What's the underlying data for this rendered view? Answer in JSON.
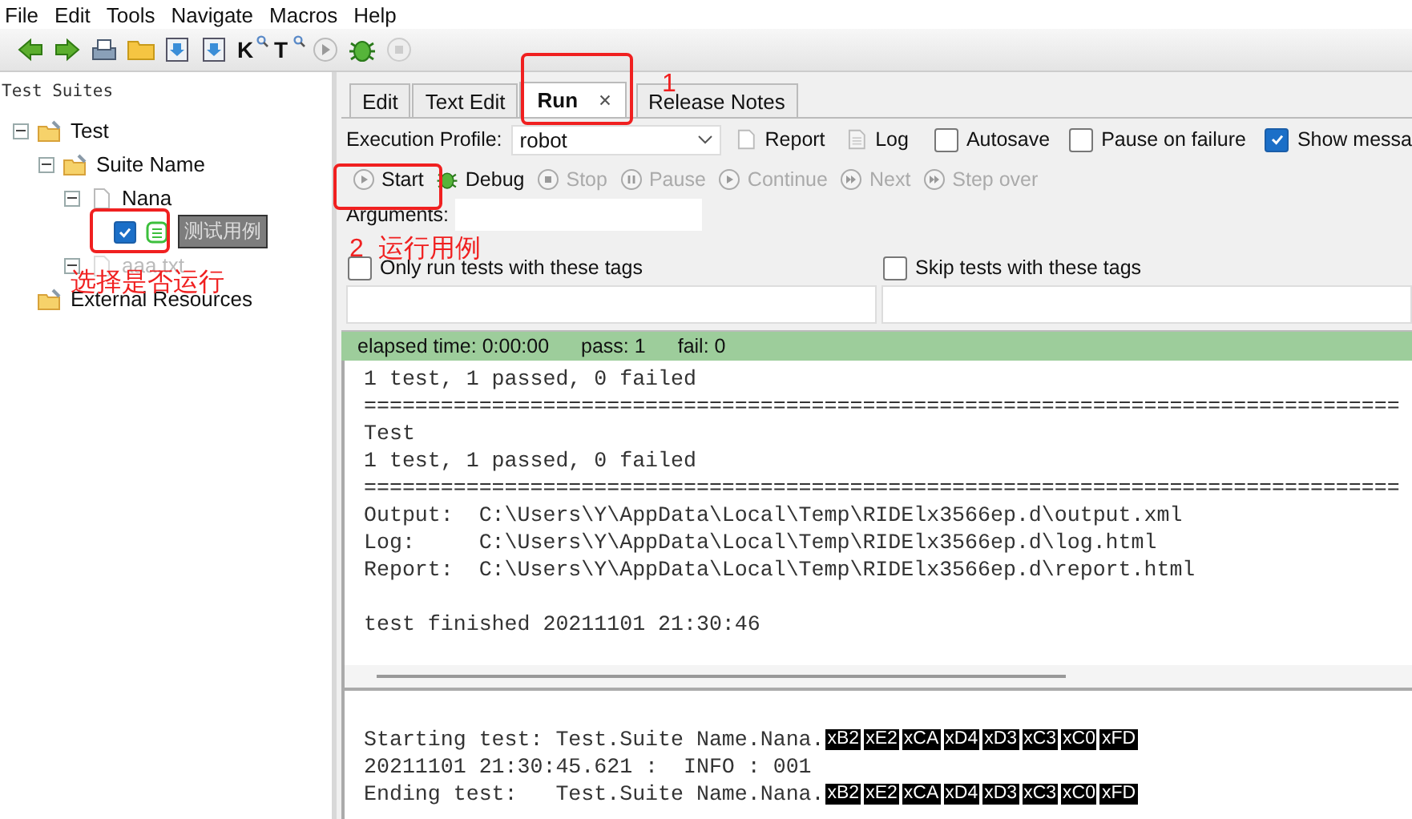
{
  "menu": [
    "File",
    "Edit",
    "Tools",
    "Navigate",
    "Macros",
    "Help"
  ],
  "toolbar": [
    {
      "kind": "back"
    },
    {
      "kind": "forward"
    },
    {
      "kind": "save"
    },
    {
      "kind": "folder"
    },
    {
      "kind": "import"
    },
    {
      "kind": "import"
    },
    {
      "kind": "search",
      "label": "K"
    },
    {
      "kind": "search",
      "label": "T"
    },
    {
      "kind": "run"
    },
    {
      "kind": "debug"
    },
    {
      "kind": "stop"
    }
  ],
  "tree": {
    "title": "Test Suites",
    "items": [
      {
        "label": "Test",
        "kind": "suite",
        "expanded": true,
        "children": [
          {
            "label": "Suite Name",
            "kind": "suite",
            "expanded": true,
            "children": [
              {
                "label": "Nana",
                "kind": "file",
                "expanded": true,
                "children": [
                  {
                    "label": "测试用例",
                    "kind": "test",
                    "checked": true,
                    "selected": true
                  }
                ]
              },
              {
                "label": "aaa.txt",
                "kind": "file",
                "expanded": true,
                "disabled": true
              }
            ]
          }
        ]
      },
      {
        "label": "External Resources",
        "kind": "suite"
      }
    ]
  },
  "tabs": [
    {
      "label": "Edit",
      "selected": false
    },
    {
      "label": "Text Edit",
      "selected": false
    },
    {
      "label": "Run",
      "selected": true
    },
    {
      "label": "Release Notes",
      "selected": false
    }
  ],
  "run": {
    "profile_label": "Execution Profile:",
    "profile": "robot",
    "report": "Report",
    "log": "Log",
    "options": [
      {
        "label": "Autosave",
        "checked": false
      },
      {
        "label": "Pause on failure",
        "checked": false
      },
      {
        "label": "Show messa",
        "checked": true
      }
    ],
    "controls": [
      {
        "label": "Start",
        "kind": "play",
        "disabled": false
      },
      {
        "label": "Debug",
        "kind": "bug",
        "disabled": false
      },
      {
        "label": "Stop",
        "kind": "stop",
        "disabled": true
      },
      {
        "label": "Pause",
        "kind": "pause",
        "disabled": true
      },
      {
        "label": "Continue",
        "kind": "play",
        "disabled": true
      },
      {
        "label": "Next",
        "kind": "next",
        "disabled": true
      },
      {
        "label": "Step over",
        "kind": "next",
        "disabled": true
      }
    ],
    "arguments_label": "Arguments:",
    "tag_filters": [
      {
        "label": "Only run tests with these tags",
        "checked": false
      },
      {
        "label": "Skip tests with these tags",
        "checked": false
      }
    ],
    "status": {
      "elapsed": "elapsed time: 0:00:00",
      "pass": "pass: 1",
      "fail": "fail: 0"
    },
    "output": [
      "1 test, 1 passed, 0 failed",
      "=================================================================================",
      "Test",
      "1 test, 1 passed, 0 failed",
      "=================================================================================",
      "Output:  C:\\Users\\Y\\AppData\\Local\\Temp\\RIDElx3566ep.d\\output.xml",
      "Log:     C:\\Users\\Y\\AppData\\Local\\Temp\\RIDElx3566ep.d\\log.html",
      "Report:  C:\\Users\\Y\\AppData\\Local\\Temp\\RIDElx3566ep.d\\report.html"
    ],
    "finished": "test finished 20211101 21:30:46",
    "messages": [
      {
        "text": "Starting test: Test.Suite Name.Nana.",
        "bytes": [
          "xB2",
          "xE2",
          "xCA",
          "xD4",
          "xD3",
          "xC3",
          "xC0",
          "xFD"
        ]
      },
      {
        "text": "20211101 21:30:45.621 :  INFO : 001"
      },
      {
        "text": "Ending test:   Test.Suite Name.Nana.",
        "bytes": [
          "xB2",
          "xE2",
          "xCA",
          "xD4",
          "xD3",
          "xC3",
          "xC0",
          "xFD"
        ]
      }
    ]
  },
  "annotations": [
    {
      "text": "1"
    },
    {
      "text": "2  运行用例"
    },
    {
      "text": "选择是否运行"
    }
  ]
}
